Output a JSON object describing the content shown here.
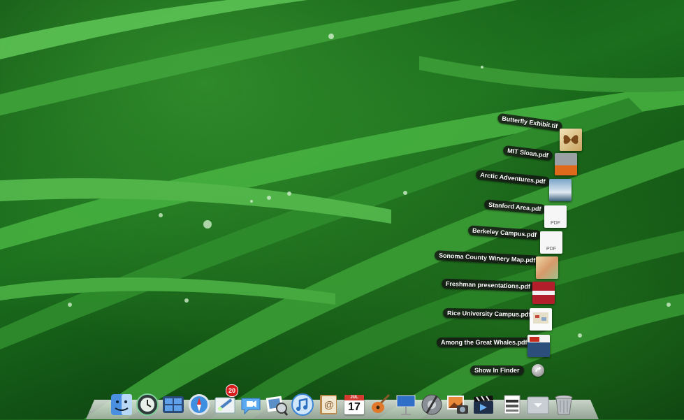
{
  "stack": {
    "items": [
      {
        "label": "Butterfly Exhibit.tif"
      },
      {
        "label": "MIT Sloan.pdf"
      },
      {
        "label": "Arctic Adventures.pdf"
      },
      {
        "label": "Stanford Area.pdf"
      },
      {
        "label": "Berkeley Campus.pdf"
      },
      {
        "label": "Sonoma County Winery Map.pdf"
      },
      {
        "label": "Freshman presentations.pdf"
      },
      {
        "label": "Rice University Campus.pdf"
      },
      {
        "label": "Among the Great Whales.pdf"
      }
    ],
    "show_in_finder": "Show In Finder"
  },
  "dock": {
    "icons": [
      "finder-icon",
      "time-machine-icon",
      "spaces-icon",
      "safari-icon",
      "mail-icon",
      "ichat-icon",
      "preview-icon",
      "itunes-icon",
      "address-book-icon",
      "ical-icon",
      "garageband-icon",
      "keynote-icon",
      "system-preferences-icon",
      "iphoto-icon",
      "imovie-icon",
      "documents-stack-icon",
      "downloads-stack-icon",
      "trash-icon"
    ],
    "mail_badge": "20",
    "ical_month": "JUL",
    "ical_day": "17"
  }
}
